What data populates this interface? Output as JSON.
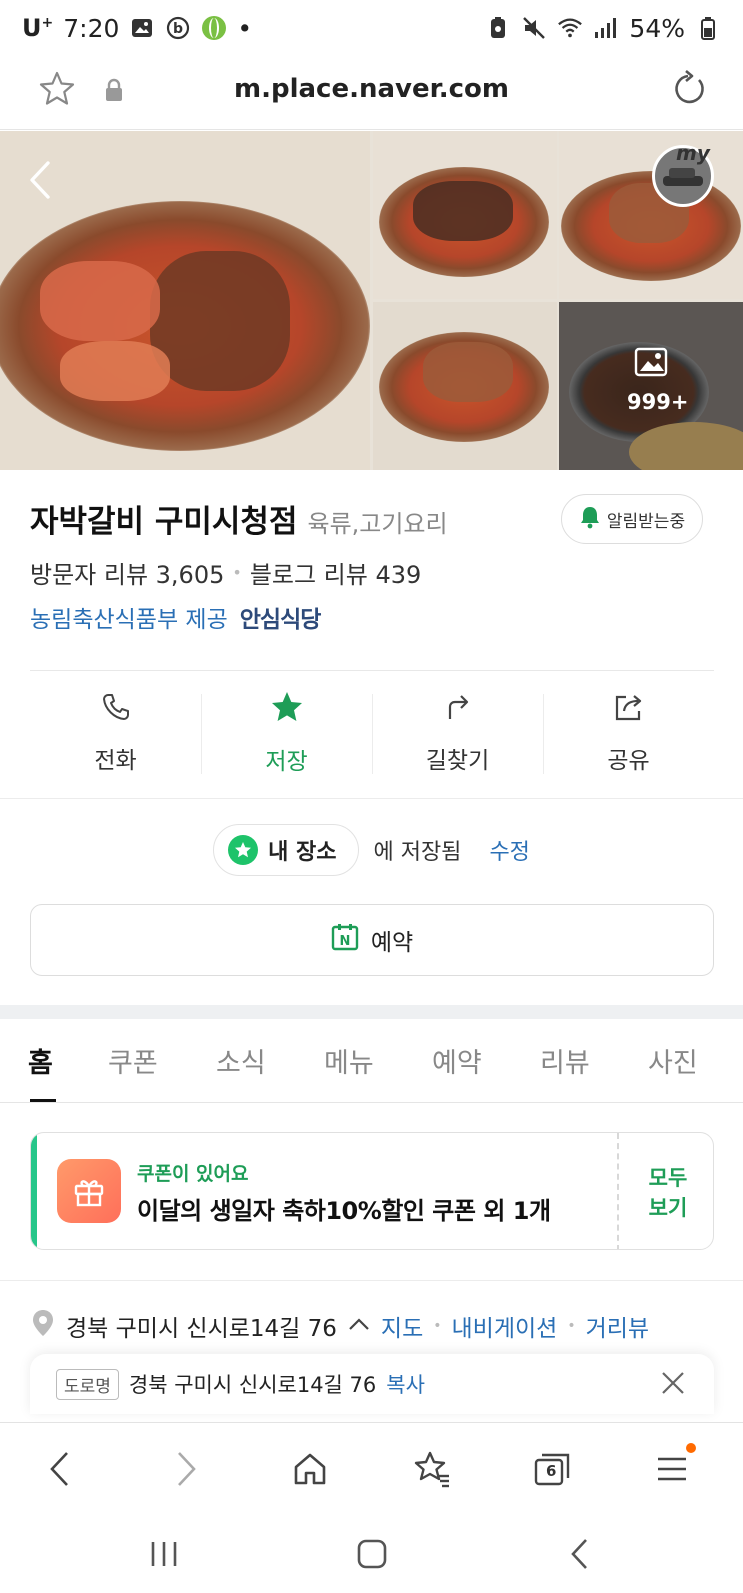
{
  "status_bar": {
    "carrier": "U",
    "carrier_sup": "+",
    "time": "7:20",
    "battery": "54%"
  },
  "url_bar": {
    "url": "m.place.naver.com"
  },
  "gallery": {
    "more_count": "999+",
    "my_label": "my"
  },
  "place": {
    "name": "자박갈비 구미시청점",
    "category": "육류,고기요리",
    "alarm_label": "알림받는중",
    "visitor_review": "방문자 리뷰 3,605",
    "blog_review": "블로그 리뷰 439",
    "provider": "농림축산식품부 제공",
    "safe_label": "안심식당"
  },
  "actions": [
    {
      "label": "전화",
      "icon": "phone-icon"
    },
    {
      "label": "저장",
      "icon": "star-icon"
    },
    {
      "label": "길찾기",
      "icon": "directions-icon"
    },
    {
      "label": "공유",
      "icon": "share-icon"
    }
  ],
  "saved": {
    "chip_label": "내 장소",
    "text": "에 저장됨",
    "edit": "수정"
  },
  "reserve": {
    "label": "예약"
  },
  "tabs": [
    "홈",
    "쿠폰",
    "소식",
    "메뉴",
    "예약",
    "리뷰",
    "사진"
  ],
  "coupon": {
    "title": "쿠폰이 있어요",
    "desc": "이달의 생일자 축하10%할인 쿠폰 외 1개",
    "see_all_1": "모두",
    "see_all_2": "보기"
  },
  "address": {
    "text": "경북 구미시 신시로14길 76",
    "links": [
      "지도",
      "내비게이션",
      "거리뷰"
    ],
    "road_tag": "도로명",
    "road_addr": "경북 구미시 신시로14길 76",
    "copy": "복사"
  },
  "toolbar": {
    "tab_count": "6"
  },
  "colors": {
    "naver_green": "#1e9d57",
    "link_blue": "#2a6fb5",
    "coupon_accent": "#27c68a"
  }
}
